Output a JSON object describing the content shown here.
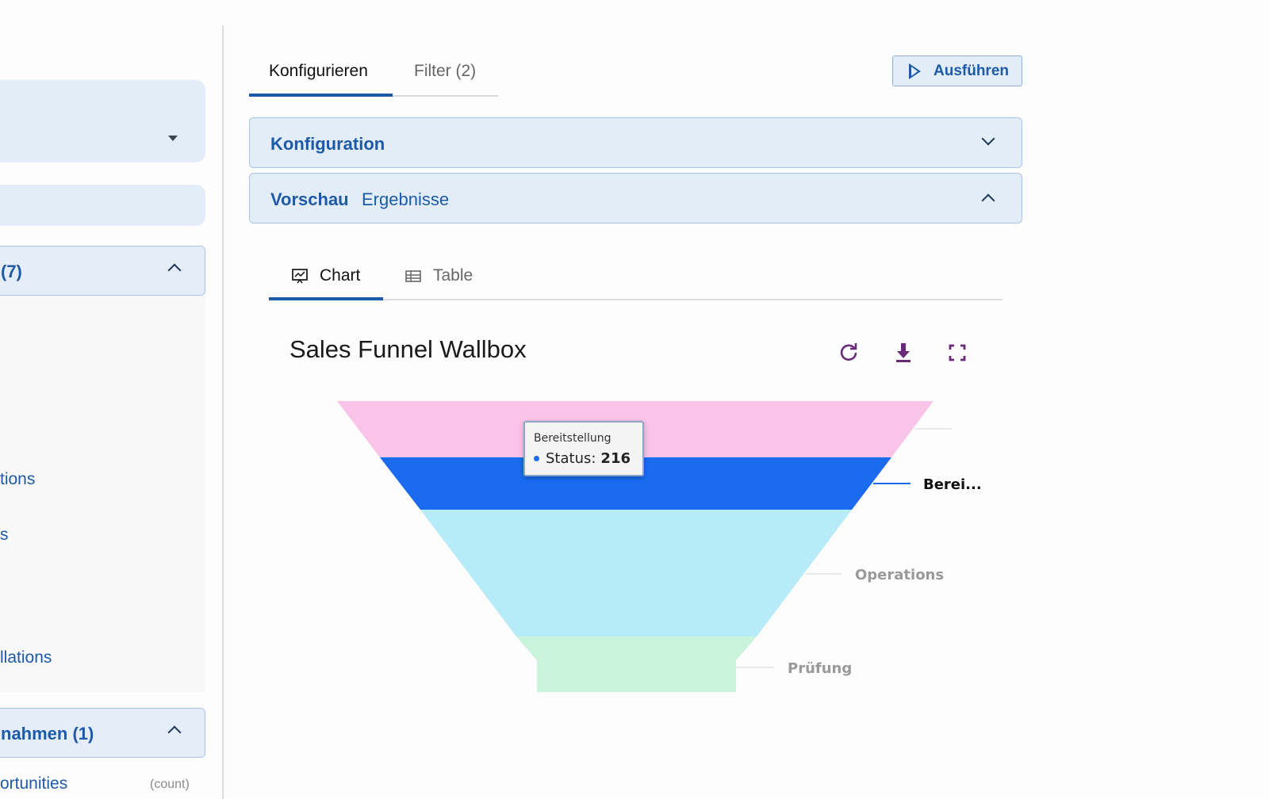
{
  "sidebar": {
    "group_a_title": "(7)",
    "links": [
      "tions",
      "s",
      "llations"
    ],
    "group_b_title": "nahmen  (1)",
    "bottom_link": "ortunities",
    "bottom_count": "(count)"
  },
  "tabs": {
    "configure": "Konfigurieren",
    "filter": "Filter (2)"
  },
  "run_button": "Ausführen",
  "accordions": {
    "config_title": "Konfiguration",
    "preview_title": "Vorschau",
    "preview_sub": "Ergebnisse"
  },
  "view_tabs": {
    "chart": "Chart",
    "table": "Table"
  },
  "colors": {
    "accent": "#1d5aa8",
    "panel": "#e3edf8"
  },
  "chart_data": {
    "type": "funnel",
    "title": "Sales Funnel Wallbox",
    "stages": [
      {
        "label": "",
        "color": "#fac4e8"
      },
      {
        "label": "Berei...",
        "full_label": "Bereitstellung",
        "value": 216,
        "color": "#1a6bf0",
        "highlighted": true
      },
      {
        "label": "Operations",
        "color": "#b6ebf7"
      },
      {
        "label": "Prüfung",
        "color": "#c9f3da"
      }
    ],
    "tooltip": {
      "title": "Bereitstellung",
      "label": "Status:",
      "value": "216"
    }
  }
}
